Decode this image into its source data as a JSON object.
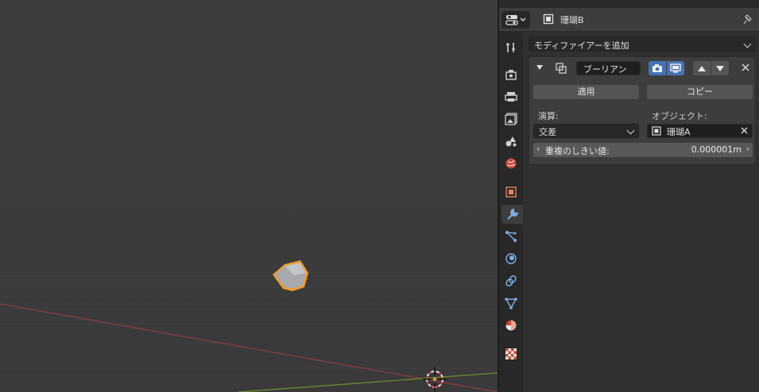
{
  "header": {
    "object_name": "珊瑚B",
    "editor_type_icon": "properties-editor-icon",
    "pin_icon": "pin-icon"
  },
  "tabs": [
    {
      "name": "tool-tab-icon"
    },
    {
      "name": "render-tab-icon"
    },
    {
      "name": "output-tab-icon"
    },
    {
      "name": "view-layer-tab-icon"
    },
    {
      "name": "scene-tab-icon"
    },
    {
      "name": "world-tab-icon"
    },
    {
      "name": "object-tab-icon"
    },
    {
      "name": "modifier-tab-icon",
      "active": true
    },
    {
      "name": "particles-tab-icon"
    },
    {
      "name": "physics-tab-icon"
    },
    {
      "name": "constraints-tab-icon"
    },
    {
      "name": "data-tab-icon"
    },
    {
      "name": "material-tab-icon"
    },
    {
      "name": "texture-tab-icon"
    }
  ],
  "modifiers": {
    "add_label": "モディファイアーを追加",
    "panel": {
      "name": "ブーリアン",
      "apply_label": "適用",
      "copy_label": "コピー",
      "operation_label": "演算:",
      "operation_value": "交差",
      "object_label": "オブジェクト:",
      "object_value": "珊瑚A",
      "threshold_label": "重複のしきい値:",
      "threshold_value": "0.000001m"
    }
  },
  "colors": {
    "accent_blue": "#4772b3",
    "selection_outline": "#f39a2b",
    "x_axis": "#8a3b45",
    "y_axis": "#6b8a2f"
  }
}
